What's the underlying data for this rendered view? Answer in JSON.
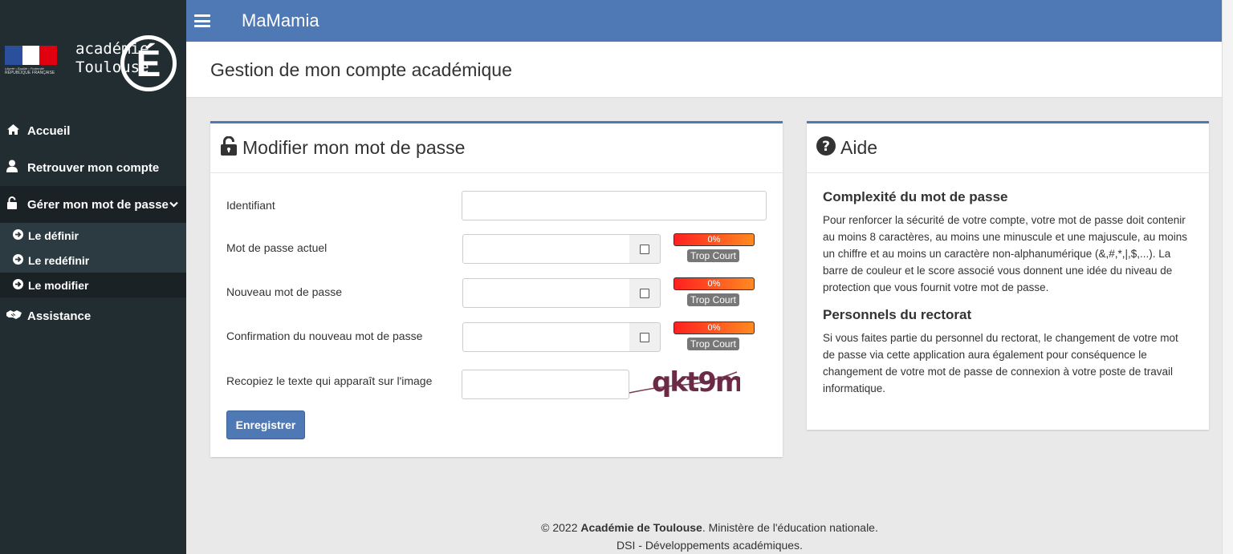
{
  "sidebar": {
    "brand": {
      "flag_motto": "Liberté • Égalité • Fraternité",
      "republic": "RÉPUBLIQUE FRANÇAISE",
      "acad_line1": "académie",
      "acad_line2": "Toulouse",
      "emblem": "É"
    },
    "items": [
      {
        "label": "Accueil",
        "icon": "home-icon"
      },
      {
        "label": "Retrouver mon compte",
        "icon": "user-icon"
      },
      {
        "label": "Gérer mon mot de passe",
        "icon": "unlock-icon"
      },
      {
        "label": "Assistance",
        "icon": "handshake-icon"
      }
    ],
    "subitems": [
      {
        "label": "Le définir",
        "icon": "arrow-circle-right-icon"
      },
      {
        "label": "Le redéfinir",
        "icon": "arrow-circle-right-icon"
      },
      {
        "label": "Le modifier",
        "icon": "arrow-circle-right-icon"
      }
    ]
  },
  "topbar": {
    "title": "MaMamia"
  },
  "page": {
    "title": "Gestion de mon compte académique"
  },
  "form": {
    "title": "Modifier mon mot de passe",
    "identifiant_label": "Identifiant",
    "identifiant_value": "",
    "current_label": "Mot de passe actuel",
    "new_label": "Nouveau mot de passe",
    "confirm_label": "Confirmation du nouveau mot de passe",
    "meter_text": "0%",
    "strength_text": "Trop Court",
    "captcha_label": "Recopiez le texte qui apparaît sur l'image",
    "captcha_text": "qkt9m",
    "submit_label": "Enregistrer"
  },
  "help": {
    "title": "Aide",
    "section1_title": "Complexité du mot de passe",
    "section1_text": "Pour renforcer la sécurité de votre compte, votre mot de passe doit contenir au moins 8 caractères, au moins une minuscule et une majuscule, au moins un chiffre et au moins un caractère non-alphanumérique (&,#,*,|,$,...). La barre de couleur et le score associé vous donnent une idée du niveau de protection que vous fournit votre mot de passe.",
    "section2_title": "Personnels du rectorat",
    "section2_text": "Si vous faites partie du personnel du rectorat, le changement de votre mot de passe via cette application aura également pour conséquence le changement de votre mot de passe de connexion à votre poste de travail informatique."
  },
  "footer": {
    "copyright": "© 2022 ",
    "org": "Académie de Toulouse",
    "ministry": ". Ministère de l'éducation nationale.",
    "line2": "DSI - Développements académiques."
  },
  "colors": {
    "primary": "#4f79b5",
    "sidebar": "#222d32",
    "sidebar_active": "#1a2226",
    "meter_start": "#ff2020",
    "meter_end": "#ff8a20"
  }
}
